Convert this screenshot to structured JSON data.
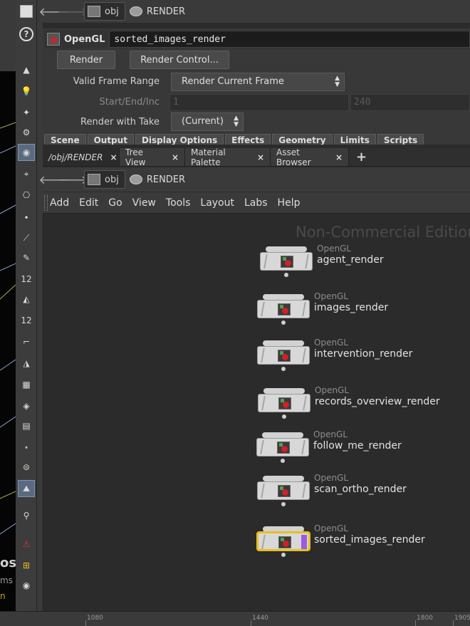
{
  "viewport": {
    "texts": [
      {
        "text": "os",
        "style": "big"
      },
      {
        "text": "ms",
        "style": ""
      },
      {
        "text": "n",
        "style": "yel"
      }
    ]
  },
  "toolbar": {
    "tools": [
      {
        "name": "add-light-icon",
        "glyph": "▲"
      },
      {
        "name": "point-light-icon",
        "glyph": "💡"
      },
      {
        "name": "spot-light-icon",
        "glyph": "✦"
      },
      {
        "name": "area-light-icon",
        "glyph": "⚙"
      },
      {
        "name": "sky-light-icon",
        "glyph": "◉"
      },
      {
        "name": "camera-icon",
        "glyph": "⌖"
      },
      {
        "name": "stereo-camera-icon",
        "glyph": "⎔"
      },
      {
        "name": "point-icon",
        "glyph": "•"
      },
      {
        "name": "brush-icon",
        "glyph": "⟋"
      },
      {
        "name": "pen-icon",
        "glyph": "✎"
      },
      {
        "name": "count-12-icon",
        "glyph": "12"
      },
      {
        "name": "paint-icon",
        "glyph": "◭"
      },
      {
        "name": "count-12b-icon",
        "glyph": "12"
      },
      {
        "name": "curve-icon",
        "glyph": "⌐"
      },
      {
        "name": "sculpt-icon",
        "glyph": "◮"
      },
      {
        "name": "checker-icon",
        "glyph": "▦"
      },
      {
        "name": "diamond-icon",
        "glyph": "◈"
      },
      {
        "name": "map-icon",
        "glyph": "▤"
      },
      {
        "name": "node-link-icon",
        "glyph": "⋆"
      },
      {
        "name": "disc-icon",
        "glyph": "⊜"
      },
      {
        "name": "landscape-icon",
        "glyph": "⛰"
      },
      {
        "name": "pin-icon",
        "glyph": "⚲"
      },
      {
        "name": "warning-icon",
        "glyph": "⚠"
      },
      {
        "name": "grid-view-icon",
        "glyph": "⊞"
      },
      {
        "name": "eye-icon",
        "glyph": "◉"
      }
    ]
  },
  "topPath": {
    "crumb1": "obj",
    "crumb2": "RENDER"
  },
  "params": {
    "nodeType": "OpenGL",
    "nodeName": "sorted_images_render",
    "renderButton": "Render",
    "renderControlButton": "Render Control...",
    "validFrameRangeLabel": "Valid Frame Range",
    "validFrameRangeValue": "Render Current Frame",
    "startEndIncLabel": "Start/End/Inc",
    "startValue": "1",
    "endValue": "240",
    "renderWithTakeLabel": "Render with Take",
    "renderWithTakeValue": "(Current)",
    "tabs": [
      "Scene",
      "Output",
      "Display Options",
      "Effects",
      "Geometry",
      "Limits",
      "Scripts"
    ]
  },
  "paneTabs": [
    {
      "label": "/obj/RENDER",
      "active": true
    },
    {
      "label": "Tree View",
      "active": false
    },
    {
      "label": "Material Palette",
      "active": false
    },
    {
      "label": "Asset Browser",
      "active": false
    }
  ],
  "paneTabsPlus": "+",
  "paneTabsClose": "×",
  "netPath": {
    "crumb1": "obj",
    "crumb2": "RENDER"
  },
  "netMenu": [
    "Add",
    "Edit",
    "Go",
    "View",
    "Tools",
    "Layout",
    "Labs",
    "Help"
  ],
  "watermark": "Non-Commercial Edition",
  "nodes": [
    {
      "type": "OpenGL",
      "name": "agent_render",
      "selected": false
    },
    {
      "type": "OpenGL",
      "name": "images_render",
      "selected": false
    },
    {
      "type": "OpenGL",
      "name": "intervention_render",
      "selected": false
    },
    {
      "type": "OpenGL",
      "name": "records_overview_render",
      "selected": false
    },
    {
      "type": "OpenGL",
      "name": "follow_me_render",
      "selected": false
    },
    {
      "type": "OpenGL",
      "name": "scan_ortho_render",
      "selected": false
    },
    {
      "type": "OpenGL",
      "name": "sorted_images_render",
      "selected": true
    }
  ],
  "ruler": [
    "1080",
    "1440",
    "1800",
    "1905"
  ],
  "colors": {
    "selectionOutline": "#e8c020",
    "renderFlag": "#9c5ce0",
    "background": "#2b2b2b"
  }
}
